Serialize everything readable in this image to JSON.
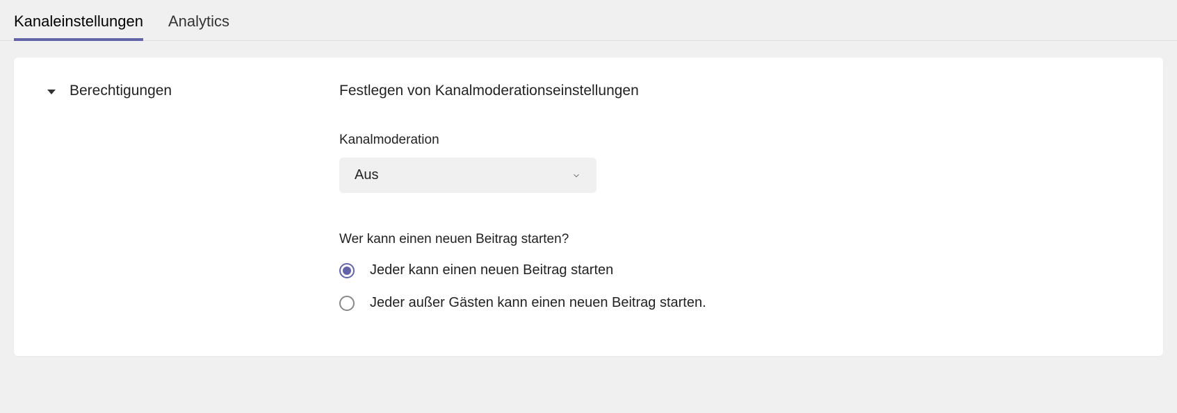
{
  "tabs": {
    "settings": "Kanaleinstellungen",
    "analytics": "Analytics"
  },
  "section": {
    "title": "Berechtigungen",
    "description": "Festlegen von Kanalmoderationseinstellungen"
  },
  "moderation": {
    "label": "Kanalmoderation",
    "value": "Aus"
  },
  "postQuestion": {
    "label": "Wer kann einen neuen Beitrag starten?",
    "options": [
      "Jeder kann einen neuen Beitrag starten",
      "Jeder außer Gästen kann einen neuen Beitrag starten."
    ]
  }
}
